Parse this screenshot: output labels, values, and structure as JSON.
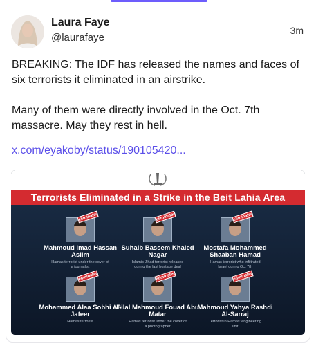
{
  "post": {
    "author": "Laura Faye",
    "handle": "@laurafaye",
    "time": "3m",
    "paragraphs": [
      "BREAKING: The IDF has released the names and faces of six terrorists it eliminated in an airstrike.",
      "Many of them were directly involved in the Oct. 7th massacre. May they rest in hell."
    ],
    "link": "x.com/eyakoby/status/190105420..."
  },
  "media": {
    "title": "Terrorists Eliminated in a Strike in the Beit Lahia Area",
    "badge": "eliminated",
    "people": [
      {
        "name": "Mahmoud Imad Hassan Aslim",
        "desc": "Hamas terrorist under the cover of a journalist"
      },
      {
        "name": "Suhaib Bassem Khaled Nagar",
        "desc": "Islamic Jihad terrorist released during the last hostage deal"
      },
      {
        "name": "Mostafa Mohammed Shaaban Hamad",
        "desc": "Hamas terrorist who infiltrated Israel during Oct 7th"
      },
      {
        "name": "Mohammed Alaa Sobhi Al-Jafeer",
        "desc": "Hamas terrorist"
      },
      {
        "name": "Bilal Mahmoud Fouad Abu Matar",
        "desc": "Hamas terrorist under the cover of a photographer"
      },
      {
        "name": "Mahmoud Yahya Rashdi Al-Sarraj",
        "desc": "Terrorist in Hamas' engineering unit"
      }
    ]
  },
  "colors": {
    "accent": "#6d5dfc",
    "link": "#5b4fe9",
    "banner": "#d42b30"
  }
}
